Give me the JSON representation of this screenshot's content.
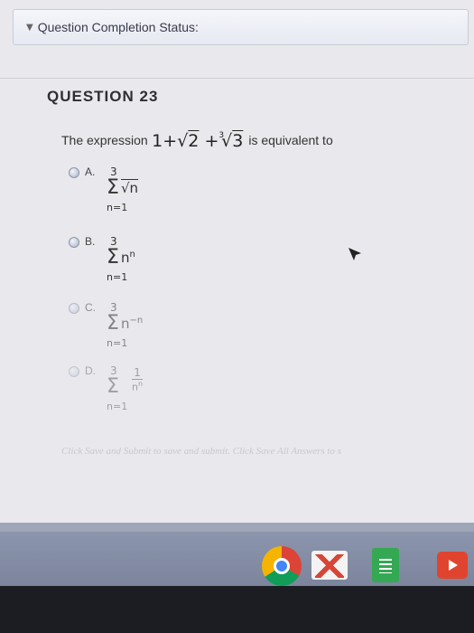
{
  "status_bar": {
    "label": "Question Completion Status:"
  },
  "question": {
    "heading": "QUESTION 23",
    "stem_before": "The expression",
    "expression": {
      "one": "1",
      "plus1": "+",
      "sqrt_sign": "√",
      "radicand1": "2",
      "plus2": "+",
      "root_index": "3",
      "radicand2": "3"
    },
    "stem_after": "is equivalent to"
  },
  "options": [
    {
      "label": "A.",
      "upper": "3",
      "term": "√n",
      "lower": "n=1"
    },
    {
      "label": "B.",
      "upper": "3",
      "term_base": "n",
      "term_exp": "n",
      "lower": "n=1"
    },
    {
      "label": "C.",
      "upper": "3",
      "term_base": "n",
      "term_exp": "−n",
      "lower": "n=1"
    },
    {
      "label": "D.",
      "upper": "3",
      "numerator": "1",
      "den_base": "n",
      "den_exp": "n",
      "lower": "n=1"
    }
  ],
  "hint": "Click Save and Submit to save and submit. Click Save All Answers to s",
  "shelf": {
    "icons": [
      "chrome-icon",
      "gmail-icon",
      "docs-icon",
      "youtube-icon"
    ]
  }
}
